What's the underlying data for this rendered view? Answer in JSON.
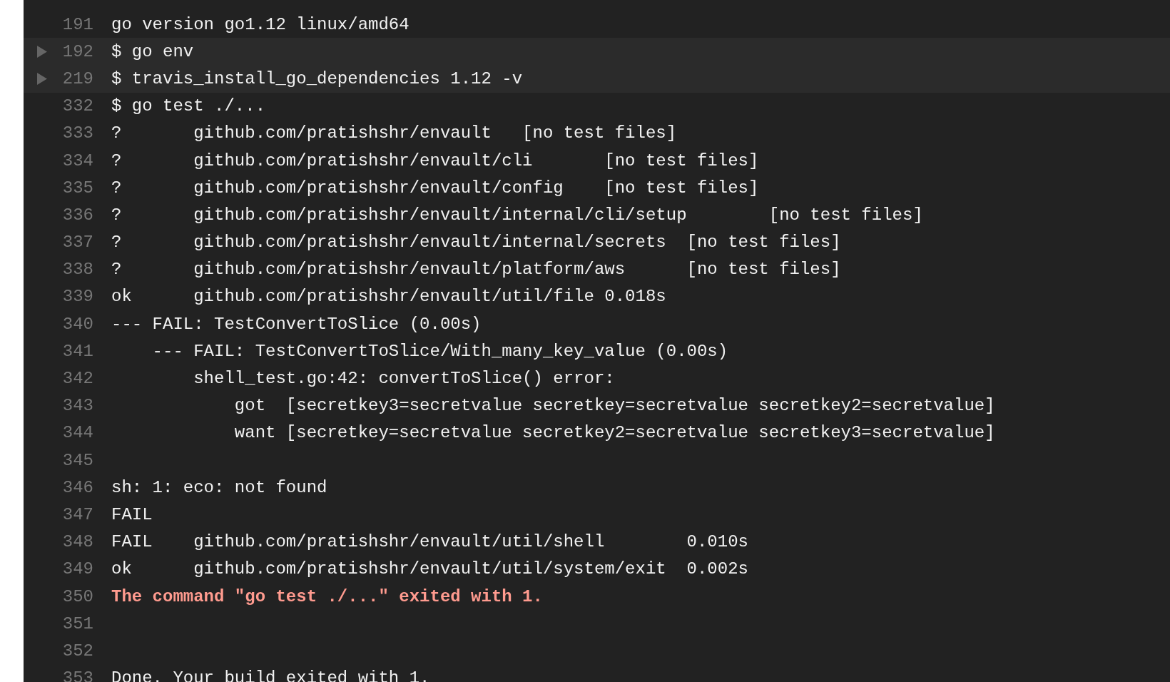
{
  "log_lines": [
    {
      "number": "191",
      "text": "go version go1.12 linux/amd64",
      "kind": "normal",
      "expandable": false
    },
    {
      "number": "192",
      "text": "$ go env",
      "kind": "normal",
      "expandable": true
    },
    {
      "number": "219",
      "text": "$ travis_install_go_dependencies 1.12 -v",
      "kind": "normal",
      "expandable": true
    },
    {
      "number": "332",
      "text": "$ go test ./...",
      "kind": "normal",
      "expandable": false
    },
    {
      "number": "333",
      "text": "?\tgithub.com/pratishshr/envault\t[no test files]",
      "kind": "normal",
      "expandable": false
    },
    {
      "number": "334",
      "text": "?\tgithub.com/pratishshr/envault/cli\t[no test files]",
      "kind": "normal",
      "expandable": false
    },
    {
      "number": "335",
      "text": "?\tgithub.com/pratishshr/envault/config\t[no test files]",
      "kind": "normal",
      "expandable": false
    },
    {
      "number": "336",
      "text": "?\tgithub.com/pratishshr/envault/internal/cli/setup\t[no test files]",
      "kind": "normal",
      "expandable": false
    },
    {
      "number": "337",
      "text": "?\tgithub.com/pratishshr/envault/internal/secrets\t[no test files]",
      "kind": "normal",
      "expandable": false
    },
    {
      "number": "338",
      "text": "?\tgithub.com/pratishshr/envault/platform/aws\t[no test files]",
      "kind": "normal",
      "expandable": false
    },
    {
      "number": "339",
      "text": "ok\tgithub.com/pratishshr/envault/util/file 0.018s",
      "kind": "normal",
      "expandable": false
    },
    {
      "number": "340",
      "text": "--- FAIL: TestConvertToSlice (0.00s)",
      "kind": "normal",
      "expandable": false
    },
    {
      "number": "341",
      "text": "    --- FAIL: TestConvertToSlice/With_many_key_value (0.00s)",
      "kind": "normal",
      "expandable": false
    },
    {
      "number": "342",
      "text": "        shell_test.go:42: convertToSlice() error:",
      "kind": "normal",
      "expandable": false
    },
    {
      "number": "343",
      "text": "            got  [secretkey3=secretvalue secretkey=secretvalue secretkey2=secretvalue]",
      "kind": "normal",
      "expandable": false
    },
    {
      "number": "344",
      "text": "            want [secretkey=secretvalue secretkey2=secretvalue secretkey3=secretvalue]",
      "kind": "normal",
      "expandable": false
    },
    {
      "number": "345",
      "expandable": false
    },
    {
      "number": "346",
      "text": "sh: 1: eco: not found",
      "kind": "normal",
      "expandable": false
    },
    {
      "number": "347",
      "text": "FAIL",
      "kind": "normal",
      "expandable": false
    },
    {
      "number": "348",
      "text": "FAIL\tgithub.com/pratishshr/envault/util/shell\t0.010s",
      "kind": "normal",
      "expandable": false
    },
    {
      "number": "349",
      "text": "ok\tgithub.com/pratishshr/envault/util/system/exit\t0.002s",
      "kind": "normal",
      "expandable": false
    },
    {
      "number": "350",
      "text": "The command \"go test ./...\" exited with 1.",
      "kind": "error",
      "expandable": false
    },
    {
      "number": "351",
      "expandable": false
    },
    {
      "number": "352",
      "expandable": false
    },
    {
      "number": "353",
      "text": "Done. Your build exited with 1.",
      "kind": "normal",
      "expandable": false
    }
  ]
}
